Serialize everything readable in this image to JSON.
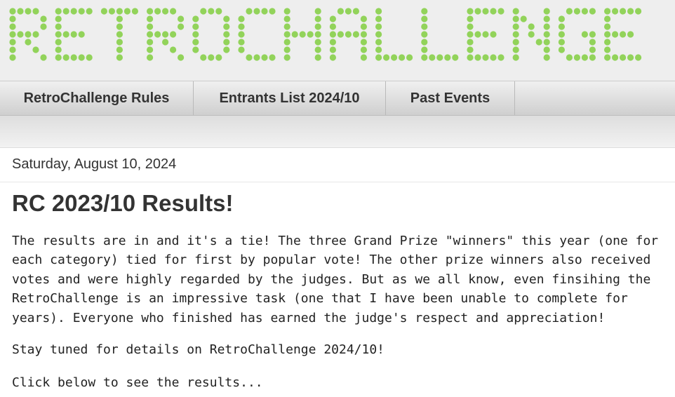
{
  "header": {
    "logo_text": "RETROCHALLENGE",
    "logo_color": "#92d35a"
  },
  "nav": {
    "tabs": [
      {
        "label": "RetroChallenge Rules"
      },
      {
        "label": "Entrants List 2024/10"
      },
      {
        "label": "Past Events"
      }
    ]
  },
  "post": {
    "date": "Saturday, August 10, 2024",
    "title": "RC 2023/10 Results!",
    "paragraphs": [
      "The results are in and it's a tie! The three Grand Prize \"winners\" this year (one for each category) tied for first by popular vote! The other prize winners also received votes and were highly regarded by the judges. But as we all know, even finsihing the RetroChallenge is an impressive task (one that I have been unable to complete for years). Everyone who finished has earned the judge's respect and appreciation!",
      "Stay tuned for details on RetroChallenge 2024/10!",
      "Click below to see the results..."
    ]
  }
}
